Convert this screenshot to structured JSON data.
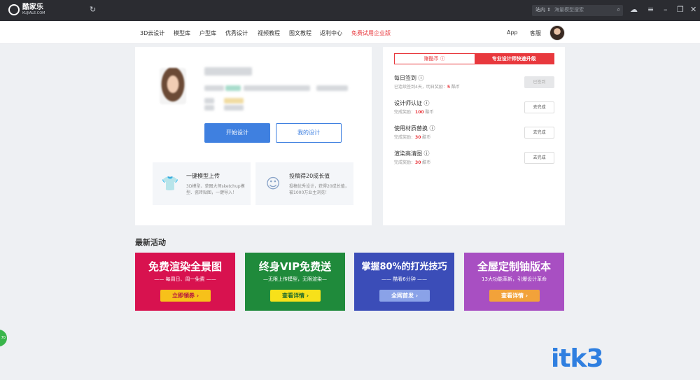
{
  "topbar": {
    "logo_text": "酷家乐",
    "logo_sub": "KUJIALE.COM",
    "refresh_icon": "↻",
    "search_scope": "站内 ⇕",
    "search_placeholder": "海量模型搜索",
    "icons": [
      "search-icon",
      "cloud-upload-icon",
      "menu-icon",
      "minimize-icon",
      "restore-icon",
      "close-icon"
    ]
  },
  "nav": {
    "items": [
      "3D云设计",
      "模型库",
      "户型库",
      "优秀设计",
      "视频教程",
      "图文教程",
      "返利中心",
      "免费试用企业版"
    ],
    "app_label": "App",
    "service_label": "客服"
  },
  "profile": {
    "start_design": "开始设计",
    "my_design": "我的设计"
  },
  "features": [
    {
      "icon": "shirt-icon",
      "title": "一键模型上传",
      "desc": "3D模型、草图大师sketchup模型、瓷砖贴图，一键导入！"
    },
    {
      "icon": "medal-icon",
      "title": "投稿得20成长值",
      "desc": "投稿优秀设计，获得20成长值，被1000万业主浏览！"
    }
  ],
  "tasks_panel": {
    "tabs": [
      "赚酷币 ⓘ",
      "专业设计师快速升级"
    ],
    "tasks": [
      {
        "title": "每日签到 ⓘ",
        "sub": "已连续签到4天，明日奖励：",
        "reward": "5",
        "unit": " 酷币",
        "button": "已签到",
        "done": true
      },
      {
        "title": "设计师认证 ⓘ",
        "sub": "完成奖励：",
        "reward": "100",
        "unit": " 酷币",
        "button": "去完成",
        "done": false
      },
      {
        "title": "使用材质替换 ⓘ",
        "sub": "完成奖励：",
        "reward": "30",
        "unit": " 酷币",
        "button": "去完成",
        "done": false
      },
      {
        "title": "渲染高清图 ⓘ",
        "sub": "完成奖励：",
        "reward": "30",
        "unit": " 酷币",
        "button": "去完成",
        "done": false
      }
    ]
  },
  "activities": {
    "title": "最新活动",
    "banners": [
      {
        "title": "免费渲染全景图",
        "sub": "—— 每周日、周一免费 ——",
        "button": "立即领券 ›",
        "bg": "#d8124f",
        "btn_bg": "#f7c11a",
        "btn_fg": "#b3113f"
      },
      {
        "title": "终身VIP免费送",
        "sub": "—无限上传模型，无限渲染—",
        "button": "查看详情 ›",
        "bg": "#1f8a3b",
        "btn_bg": "#f7e11a",
        "btn_fg": "#1f6a2b"
      },
      {
        "title": "掌握80%的打光技巧",
        "sub": "—— 酷看6分钟 ——",
        "button": "全网首发 ›",
        "bg": "#3b4db8",
        "btn_bg": "#8aa2e8",
        "btn_fg": "#ffffff"
      },
      {
        "title": "全屋定制铀版本",
        "sub": "13大功能革新，引爆设计革命",
        "button": "查看详情 ›",
        "bg": "#a84fc2",
        "btn_bg": "#f2a23a",
        "btn_fg": "#ffffff"
      }
    ]
  },
  "watermark": "itk3",
  "float_badge": "70"
}
